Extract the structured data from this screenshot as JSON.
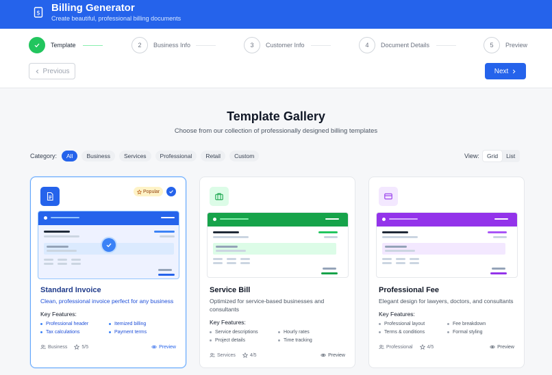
{
  "header": {
    "title": "Billing Generator",
    "subtitle": "Create beautiful, professional billing documents"
  },
  "steps": [
    {
      "number": "✓",
      "label": "Template",
      "state": "done"
    },
    {
      "number": "2",
      "label": "Business Info",
      "state": "pending"
    },
    {
      "number": "3",
      "label": "Customer Info",
      "state": "pending"
    },
    {
      "number": "4",
      "label": "Document Details",
      "state": "pending"
    },
    {
      "number": "5",
      "label": "Preview",
      "state": "pending"
    }
  ],
  "nav": {
    "previous_label": "Previous",
    "next_label": "Next"
  },
  "gallery": {
    "title": "Template Gallery",
    "subtitle": "Choose from our collection of professionally designed billing templates"
  },
  "filters": {
    "category_label": "Category:",
    "categories": [
      "All",
      "Business",
      "Services",
      "Professional",
      "Retail",
      "Custom"
    ],
    "active_category": "All",
    "view_label": "View:",
    "view_options": [
      "Grid",
      "List"
    ],
    "active_view": "Grid"
  },
  "cards": [
    {
      "title": "Standard Invoice",
      "description": "Clean, professional invoice perfect for any business",
      "key_features_label": "Key Features:",
      "features": [
        "Professional header",
        "Itemized billing",
        "Tax calculations",
        "Payment terms"
      ],
      "category": "Business",
      "rating": "5/5",
      "preview_label": "Preview",
      "badge": "Popular",
      "selected": true,
      "accent": "#2563eb",
      "icon": "document-icon"
    },
    {
      "title": "Service Bill",
      "description": "Optimized for service-based businesses and consultants",
      "key_features_label": "Key Features:",
      "features": [
        "Service descriptions",
        "Hourly rates",
        "Project details",
        "Time tracking"
      ],
      "category": "Services",
      "rating": "4/5",
      "preview_label": "Preview",
      "selected": false,
      "accent": "#16a34a",
      "icon": "briefcase-icon"
    },
    {
      "title": "Professional Fee",
      "description": "Elegant design for lawyers, doctors, and consultants",
      "key_features_label": "Key Features:",
      "features": [
        "Professional layout",
        "Fee breakdown",
        "Terms & conditions",
        "Formal styling"
      ],
      "category": "Professional",
      "rating": "4/5",
      "preview_label": "Preview",
      "selected": false,
      "accent": "#9333ea",
      "icon": "credit-card-icon"
    }
  ]
}
